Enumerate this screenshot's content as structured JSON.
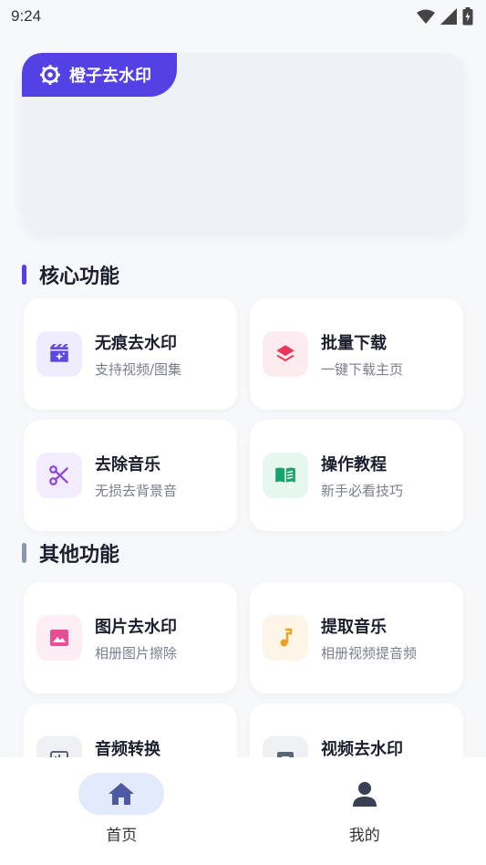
{
  "status_bar": {
    "time": "9:24"
  },
  "banner": {
    "title": "橙子去水印"
  },
  "sections": {
    "core": {
      "title": "核心功能"
    },
    "other": {
      "title": "其他功能"
    }
  },
  "cards": {
    "watermark": {
      "title": "无痕去水印",
      "subtitle": "支持视频/图集"
    },
    "batch": {
      "title": "批量下载",
      "subtitle": "一键下载主页"
    },
    "music_remove": {
      "title": "去除音乐",
      "subtitle": "无损去背景音"
    },
    "tutorial": {
      "title": "操作教程",
      "subtitle": "新手必看技巧"
    },
    "image_watermark": {
      "title": "图片去水印",
      "subtitle": "相册图片擦除"
    },
    "extract_music": {
      "title": "提取音乐",
      "subtitle": "相册视频提音频"
    },
    "audio_convert": {
      "title": "音频转换",
      "subtitle": ""
    },
    "video_watermark": {
      "title": "视频去水印",
      "subtitle": ""
    }
  },
  "nav": {
    "home": "首页",
    "mine": "我的"
  },
  "colors": {
    "accent": "#5441e6",
    "other_bar": "#8a96ab",
    "nav_active_bg": "#e3eafb"
  }
}
